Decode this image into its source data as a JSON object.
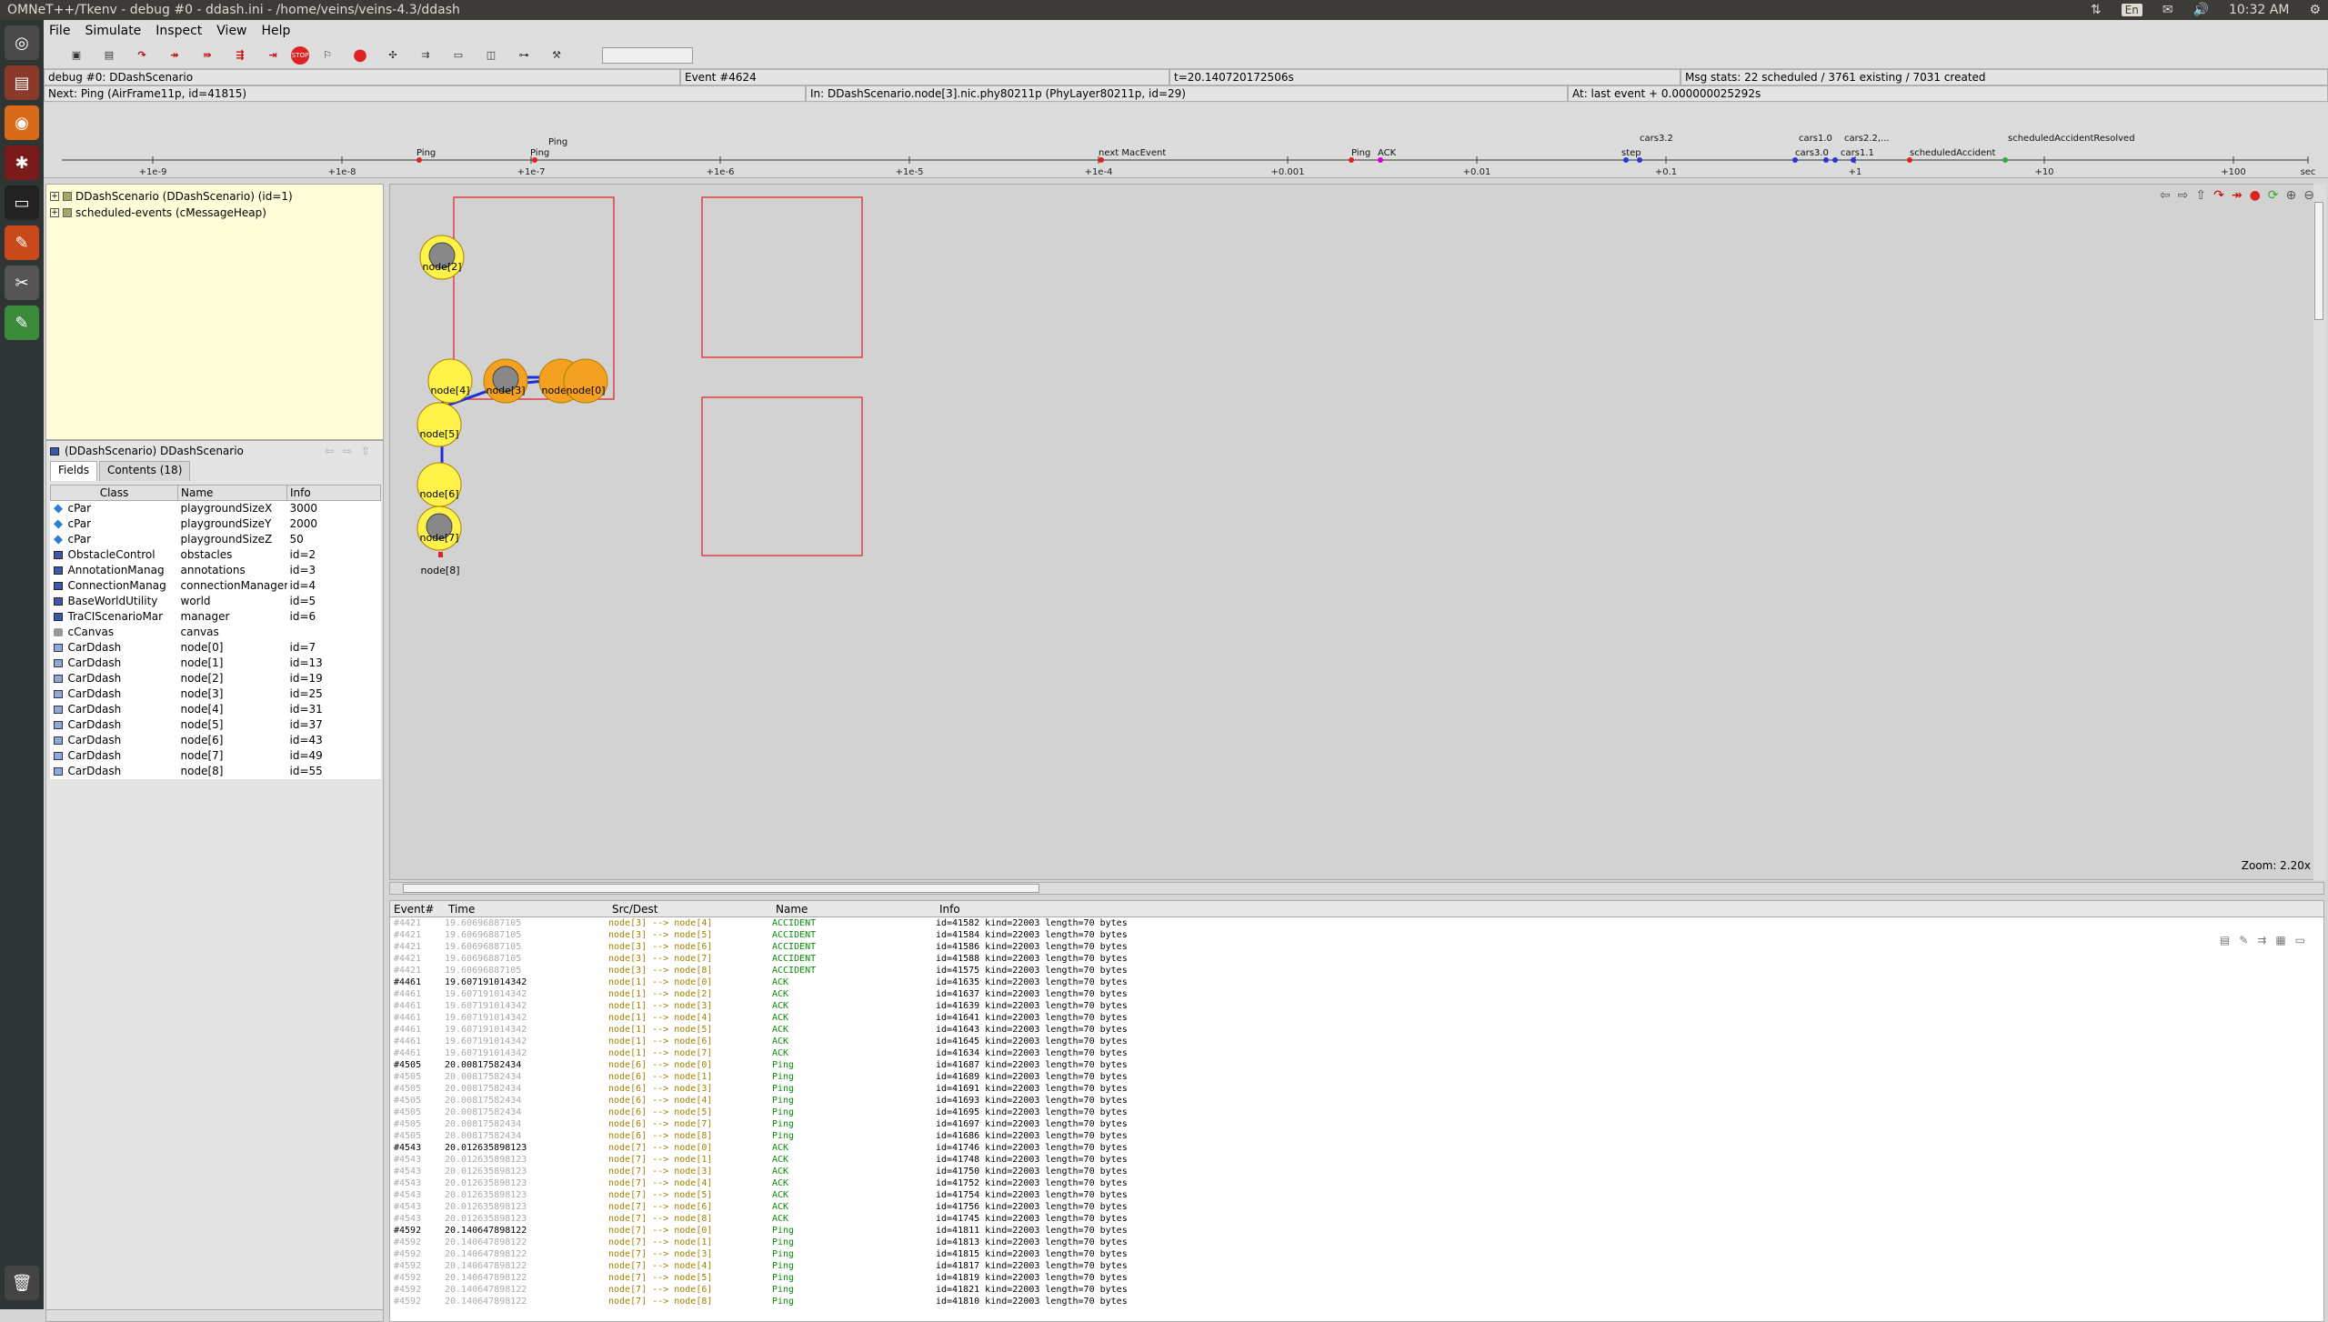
{
  "topbar": {
    "title": "OMNeT++/Tkenv - debug #0 - ddash.ini - /home/veins/veins-4.3/ddash",
    "kb": "En",
    "clock": "10:32 AM"
  },
  "menu": [
    "File",
    "Simulate",
    "Inspect",
    "View",
    "Help"
  ],
  "toolbar": [
    "new",
    "load",
    "STEP",
    "RUN",
    "FAST",
    "EXPRESS",
    "UNTIL...",
    "STOP",
    "flag",
    "REC",
    "net",
    "net2",
    "split",
    "split2",
    "split3",
    "tool"
  ],
  "status": {
    "run": "debug #0: DDashScenario",
    "event": "Event #4624",
    "time": "t=20.140720172506s",
    "msgstats": "Msg stats: 22 scheduled / 3761 existing / 7031 created",
    "next": "Next: Ping (AirFrame11p, id=41815)",
    "in": "In: DDashScenario.node[3].nic.phy80211p (PhyLayer80211p, id=29)",
    "at": "At: last event + 0.000000025292s"
  },
  "timeline": {
    "ticks": [
      "+1e-9",
      "+1e-8",
      "+1e-7",
      "+1e-6",
      "+1e-5",
      "+1e-4",
      "+0.001",
      "+0.01",
      "+0.1",
      "+1",
      "+10",
      "+100",
      "sec"
    ],
    "labels": [
      "Ping",
      "Ping",
      "Ping",
      "next MacEvent",
      "Ping",
      "ACK",
      "cars3.2",
      "step",
      "cars1.0",
      "cars3.0",
      "cars2.2,...",
      "cars1.1",
      "scheduledAccident",
      "scheduledAccidentResolved"
    ]
  },
  "tree": [
    {
      "label": "DDashScenario (DDashScenario) (id=1)"
    },
    {
      "label": "scheduled-events (cMessageHeap)"
    }
  ],
  "inspector": {
    "title": "(DDashScenario) DDashScenario",
    "tabs": [
      "Fields",
      "Contents (18)"
    ],
    "headers": [
      "Class",
      "Name",
      "Info"
    ],
    "rows": [
      {
        "icon": "diamond",
        "cls": "cPar",
        "name": "playgroundSizeX",
        "info": "3000"
      },
      {
        "icon": "diamond",
        "cls": "cPar",
        "name": "playgroundSizeY",
        "info": "2000"
      },
      {
        "icon": "diamond",
        "cls": "cPar",
        "name": "playgroundSizeZ",
        "info": "50"
      },
      {
        "icon": "box",
        "cls": "ObstacleControl",
        "name": "obstacles",
        "info": "id=2"
      },
      {
        "icon": "box",
        "cls": "AnnotationManag",
        "name": "annotations",
        "info": "id=3"
      },
      {
        "icon": "box",
        "cls": "ConnectionManag",
        "name": "connectionManager",
        "info": "id=4"
      },
      {
        "icon": "box",
        "cls": "BaseWorldUtility",
        "name": "world",
        "info": "id=5"
      },
      {
        "icon": "box",
        "cls": "TraCIScenarioMar",
        "name": "manager",
        "info": "id=6"
      },
      {
        "icon": "canvas",
        "cls": "cCanvas",
        "name": "canvas",
        "info": ""
      },
      {
        "icon": "car",
        "cls": "CarDdash",
        "name": "node[0]",
        "info": "id=7"
      },
      {
        "icon": "car",
        "cls": "CarDdash",
        "name": "node[1]",
        "info": "id=13"
      },
      {
        "icon": "car",
        "cls": "CarDdash",
        "name": "node[2]",
        "info": "id=19"
      },
      {
        "icon": "car",
        "cls": "CarDdash",
        "name": "node[3]",
        "info": "id=25"
      },
      {
        "icon": "car",
        "cls": "CarDdash",
        "name": "node[4]",
        "info": "id=31"
      },
      {
        "icon": "car",
        "cls": "CarDdash",
        "name": "node[5]",
        "info": "id=37"
      },
      {
        "icon": "car",
        "cls": "CarDdash",
        "name": "node[6]",
        "info": "id=43"
      },
      {
        "icon": "car",
        "cls": "CarDdash",
        "name": "node[7]",
        "info": "id=49"
      },
      {
        "icon": "car",
        "cls": "CarDdash",
        "name": "node[8]",
        "info": "id=55"
      }
    ]
  },
  "network": {
    "nodes": [
      "node[2]",
      "node[4]",
      "node[3]",
      "node[1]",
      "node[0]",
      "node[5]",
      "node[6]",
      "node[7]",
      "node[8]"
    ],
    "zoom": "Zoom: 2.20x"
  },
  "log": {
    "headers": [
      "Event#",
      "Time",
      "Src/Dest",
      "Name",
      "Info"
    ],
    "rows": [
      {
        "ev": "#4421",
        "t": "19.60696887105",
        "sd": "node[3] --> node[4]",
        "nm": "ACCIDENT",
        "inf": "id=41582  kind=22003 length=70 bytes",
        "dim": true
      },
      {
        "ev": "#4421",
        "t": "19.60696887105",
        "sd": "node[3] --> node[5]",
        "nm": "ACCIDENT",
        "inf": "id=41584  kind=22003 length=70 bytes",
        "dim": true
      },
      {
        "ev": "#4421",
        "t": "19.60696887105",
        "sd": "node[3] --> node[6]",
        "nm": "ACCIDENT",
        "inf": "id=41586  kind=22003 length=70 bytes",
        "dim": true
      },
      {
        "ev": "#4421",
        "t": "19.60696887105",
        "sd": "node[3] --> node[7]",
        "nm": "ACCIDENT",
        "inf": "id=41588  kind=22003 length=70 bytes",
        "dim": true
      },
      {
        "ev": "#4421",
        "t": "19.60696887105",
        "sd": "node[3] --> node[8]",
        "nm": "ACCIDENT",
        "inf": "id=41575  kind=22003 length=70 bytes",
        "dim": true
      },
      {
        "ev": "#4461",
        "t": "19.607191014342",
        "sd": "node[1] --> node[0]",
        "nm": "ACK",
        "inf": "id=41635  kind=22003 length=70 bytes",
        "dim": false
      },
      {
        "ev": "#4461",
        "t": "19.607191014342",
        "sd": "node[1] --> node[2]",
        "nm": "ACK",
        "inf": "id=41637  kind=22003 length=70 bytes",
        "dim": true
      },
      {
        "ev": "#4461",
        "t": "19.607191014342",
        "sd": "node[1] --> node[3]",
        "nm": "ACK",
        "inf": "id=41639  kind=22003 length=70 bytes",
        "dim": true
      },
      {
        "ev": "#4461",
        "t": "19.607191014342",
        "sd": "node[1] --> node[4]",
        "nm": "ACK",
        "inf": "id=41641  kind=22003 length=70 bytes",
        "dim": true
      },
      {
        "ev": "#4461",
        "t": "19.607191014342",
        "sd": "node[1] --> node[5]",
        "nm": "ACK",
        "inf": "id=41643  kind=22003 length=70 bytes",
        "dim": true
      },
      {
        "ev": "#4461",
        "t": "19.607191014342",
        "sd": "node[1] --> node[6]",
        "nm": "ACK",
        "inf": "id=41645  kind=22003 length=70 bytes",
        "dim": true
      },
      {
        "ev": "#4461",
        "t": "19.607191014342",
        "sd": "node[1] --> node[7]",
        "nm": "ACK",
        "inf": "id=41634  kind=22003 length=70 bytes",
        "dim": true
      },
      {
        "ev": "#4505",
        "t": "20.00817582434",
        "sd": "node[6] --> node[0]",
        "nm": "Ping",
        "inf": "id=41687  kind=22003 length=70 bytes",
        "dim": false
      },
      {
        "ev": "#4505",
        "t": "20.00817582434",
        "sd": "node[6] --> node[1]",
        "nm": "Ping",
        "inf": "id=41689  kind=22003 length=70 bytes",
        "dim": true
      },
      {
        "ev": "#4505",
        "t": "20.00817582434",
        "sd": "node[6] --> node[3]",
        "nm": "Ping",
        "inf": "id=41691  kind=22003 length=70 bytes",
        "dim": true
      },
      {
        "ev": "#4505",
        "t": "20.00817582434",
        "sd": "node[6] --> node[4]",
        "nm": "Ping",
        "inf": "id=41693  kind=22003 length=70 bytes",
        "dim": true
      },
      {
        "ev": "#4505",
        "t": "20.00817582434",
        "sd": "node[6] --> node[5]",
        "nm": "Ping",
        "inf": "id=41695  kind=22003 length=70 bytes",
        "dim": true
      },
      {
        "ev": "#4505",
        "t": "20.00817582434",
        "sd": "node[6] --> node[7]",
        "nm": "Ping",
        "inf": "id=41697  kind=22003 length=70 bytes",
        "dim": true
      },
      {
        "ev": "#4505",
        "t": "20.00817582434",
        "sd": "node[6] --> node[8]",
        "nm": "Ping",
        "inf": "id=41686  kind=22003 length=70 bytes",
        "dim": true
      },
      {
        "ev": "#4543",
        "t": "20.012635898123",
        "sd": "node[7] --> node[0]",
        "nm": "ACK",
        "inf": "id=41746  kind=22003 length=70 bytes",
        "dim": false
      },
      {
        "ev": "#4543",
        "t": "20.012635898123",
        "sd": "node[7] --> node[1]",
        "nm": "ACK",
        "inf": "id=41748  kind=22003 length=70 bytes",
        "dim": true
      },
      {
        "ev": "#4543",
        "t": "20.012635898123",
        "sd": "node[7] --> node[3]",
        "nm": "ACK",
        "inf": "id=41750  kind=22003 length=70 bytes",
        "dim": true
      },
      {
        "ev": "#4543",
        "t": "20.012635898123",
        "sd": "node[7] --> node[4]",
        "nm": "ACK",
        "inf": "id=41752  kind=22003 length=70 bytes",
        "dim": true
      },
      {
        "ev": "#4543",
        "t": "20.012635898123",
        "sd": "node[7] --> node[5]",
        "nm": "ACK",
        "inf": "id=41754  kind=22003 length=70 bytes",
        "dim": true
      },
      {
        "ev": "#4543",
        "t": "20.012635898123",
        "sd": "node[7] --> node[6]",
        "nm": "ACK",
        "inf": "id=41756  kind=22003 length=70 bytes",
        "dim": true
      },
      {
        "ev": "#4543",
        "t": "20.012635898123",
        "sd": "node[7] --> node[8]",
        "nm": "ACK",
        "inf": "id=41745  kind=22003 length=70 bytes",
        "dim": true
      },
      {
        "ev": "#4592",
        "t": "20.140647898122",
        "sd": "node[7] --> node[0]",
        "nm": "Ping",
        "inf": "id=41811  kind=22003 length=70 bytes",
        "dim": false
      },
      {
        "ev": "#4592",
        "t": "20.140647898122",
        "sd": "node[7] --> node[1]",
        "nm": "Ping",
        "inf": "id=41813  kind=22003 length=70 bytes",
        "dim": true
      },
      {
        "ev": "#4592",
        "t": "20.140647898122",
        "sd": "node[7] --> node[3]",
        "nm": "Ping",
        "inf": "id=41815  kind=22003 length=70 bytes",
        "dim": true
      },
      {
        "ev": "#4592",
        "t": "20.140647898122",
        "sd": "node[7] --> node[4]",
        "nm": "Ping",
        "inf": "id=41817  kind=22003 length=70 bytes",
        "dim": true
      },
      {
        "ev": "#4592",
        "t": "20.140647898122",
        "sd": "node[7] --> node[5]",
        "nm": "Ping",
        "inf": "id=41819  kind=22003 length=70 bytes",
        "dim": true
      },
      {
        "ev": "#4592",
        "t": "20.140647898122",
        "sd": "node[7] --> node[6]",
        "nm": "Ping",
        "inf": "id=41821  kind=22003 length=70 bytes",
        "dim": true
      },
      {
        "ev": "#4592",
        "t": "20.140647898122",
        "sd": "node[7] --> node[8]",
        "nm": "Ping",
        "inf": "id=41810  kind=22003 length=70 bytes",
        "dim": true
      }
    ]
  }
}
